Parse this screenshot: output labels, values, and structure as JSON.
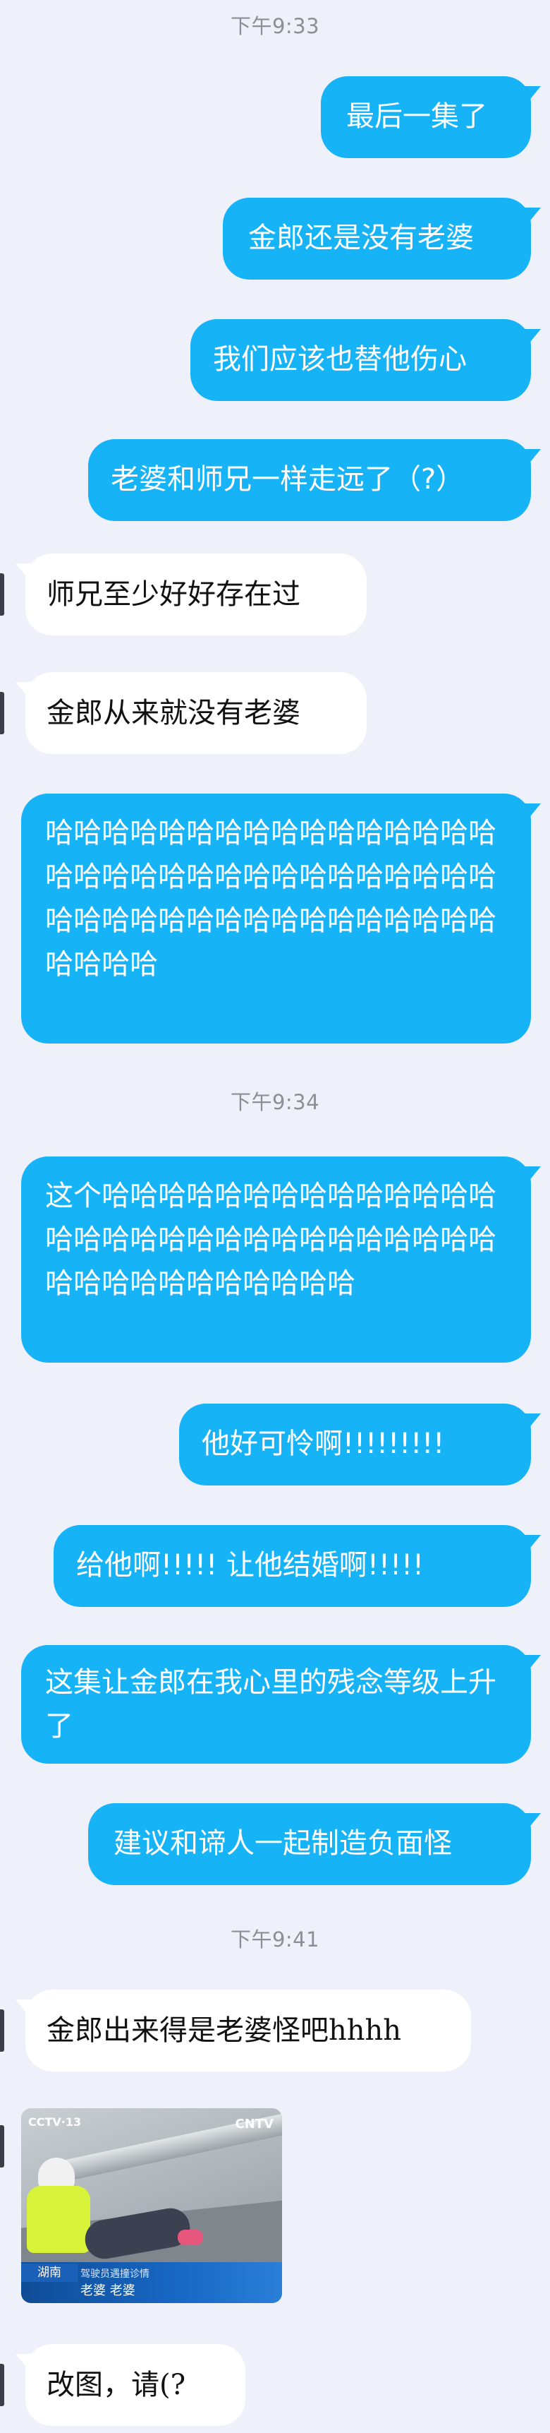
{
  "colors": {
    "background": "#eef1f9",
    "sent_bubble": "#17b3f7",
    "received_bubble": "#ffffff",
    "timestamp": "#8a8f9a"
  },
  "timestamps": [
    "下午9:33",
    "下午9:34",
    "下午9:41"
  ],
  "messages": [
    {
      "side": "sent",
      "text": "最后一集了"
    },
    {
      "side": "sent",
      "text": "金郎还是没有老婆"
    },
    {
      "side": "sent",
      "text": "我们应该也替他伤心"
    },
    {
      "side": "sent",
      "text": "老婆和师兄一样走远了（?）"
    },
    {
      "side": "received",
      "text": "师兄至少好好存在过"
    },
    {
      "side": "received",
      "text": "金郎从来就没有老婆"
    },
    {
      "side": "sent",
      "text": "哈哈哈哈哈哈哈哈哈哈哈哈哈哈哈哈哈哈哈哈哈哈哈哈哈哈哈哈哈哈哈哈哈哈哈哈哈哈哈哈哈哈哈哈哈哈哈哈哈哈哈哈"
    },
    {
      "side": "sent",
      "text": "这个哈哈哈哈哈哈哈哈哈哈哈哈哈哈哈哈哈哈哈哈哈哈哈哈哈哈哈哈哈哈哈哈哈哈哈哈哈哈哈哈哈"
    },
    {
      "side": "sent",
      "text": "他好可怜啊!!!!!!!!!"
    },
    {
      "side": "sent",
      "text": "给他啊!!!!! 让他结婚啊!!!!!"
    },
    {
      "side": "sent",
      "text": "这集让金郎在我心里的残念等级上升了"
    },
    {
      "side": "sent",
      "text": "建议和谛人一起制造负面怪"
    },
    {
      "side": "received",
      "text": "金郎出来得是老婆怪吧hhhh"
    },
    {
      "side": "received",
      "type": "image",
      "image": {
        "logo_left": "CCTV·13",
        "logo_right": "CNTV",
        "tag": "湖南",
        "subline": "驾驶员遇撞诊情",
        "caption": "老婆 老婆"
      }
    },
    {
      "side": "received",
      "text": "改图，请(?"
    }
  ]
}
